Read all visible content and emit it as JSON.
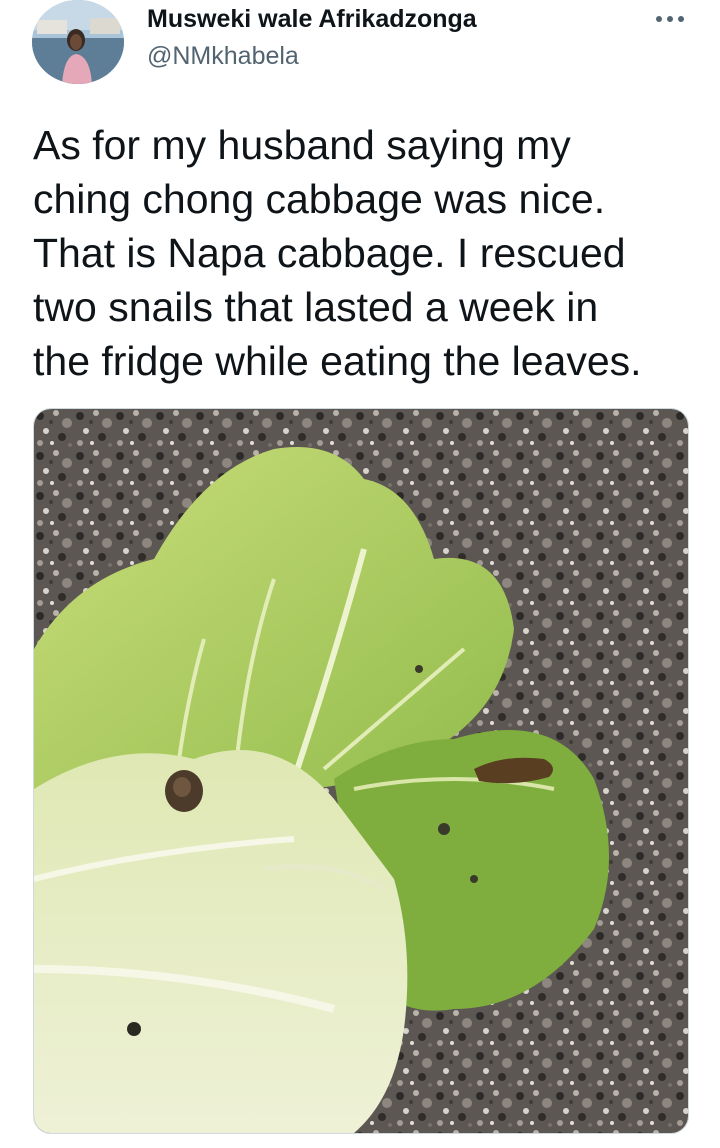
{
  "author": {
    "display_name": "Musweki wale Afrikadzonga",
    "handle": "@NMkhabela",
    "avatar_icon": "profile-photo"
  },
  "menu": {
    "more_icon": "more-horizontal-icon"
  },
  "tweet": {
    "text_lines": [
      "As for my husband saying my",
      "ching chong cabbage was nice.",
      "That is Napa cabbage. I rescued",
      "two snails that lasted a week in",
      "the fridge while eating the leaves."
    ]
  },
  "colors": {
    "text_primary": "#0f1419",
    "text_secondary": "#536471",
    "card_border": "#cfd9de"
  }
}
